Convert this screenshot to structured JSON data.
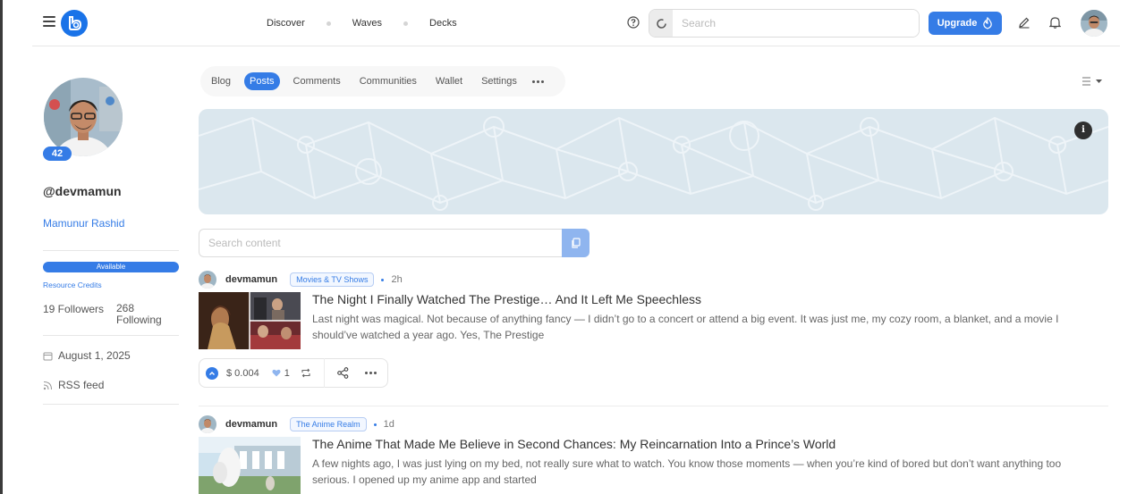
{
  "nav": {
    "links": [
      "Discover",
      "Waves",
      "Decks"
    ],
    "search_placeholder": "Search",
    "upgrade_label": "Upgrade"
  },
  "profile": {
    "reputation": "42",
    "username": "@devmamun",
    "full_name": "Mamunur Rashid",
    "rc_status": "Available",
    "rc_label": "Resource Credits",
    "followers": "19 Followers",
    "following": "268 Following",
    "joined": "August 1, 2025",
    "rss": "RSS feed"
  },
  "tabs": [
    "Blog",
    "Posts",
    "Comments",
    "Communities",
    "Wallet",
    "Settings"
  ],
  "active_tab": "Posts",
  "cover": {
    "info": "i"
  },
  "content_search": {
    "placeholder": "Search content"
  },
  "posts": [
    {
      "author": "devmamun",
      "community": "Movies & TV Shows",
      "time": "2h",
      "title": "The Night I Finally Watched The Prestige… And It Left Me Speechless",
      "excerpt": "Last night was magical. Not because of anything fancy — I didn’t go to a concert or attend a big event. It was just me, my cozy room, a blanket, and a movie I should’ve watched a year ago. Yes, The Prestige",
      "payout": "$ 0.004",
      "votes": "1"
    },
    {
      "author": "devmamun",
      "community": "The Anime Realm",
      "time": "1d",
      "title": "The Anime That Made Me Believe in Second Chances: My Reincarnation Into a Prince’s World",
      "excerpt": "A few nights ago, I was just lying on my bed, not really sure what to watch. You know those moments — when you’re kind of bored but don’t want anything too serious. I opened up my anime app and started"
    }
  ],
  "colors": {
    "accent": "#357ce6",
    "cover_bg": "#dbe7ee",
    "text": "#333333"
  }
}
